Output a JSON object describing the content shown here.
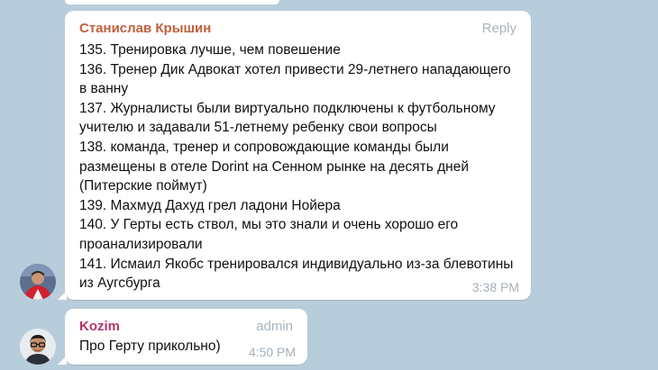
{
  "messages": [
    {
      "sender": "Станислав Крышин",
      "action": "Reply",
      "lines": [
        "135. Тренировка лучше, чем повешение",
        "136. Тренер Дик Адвокат хотел привести 29-летнего нападающего в ванну",
        "137. Журналисты были виртуально подключены к футбольному учителю и задавали 51-летнему ребенку свои вопросы",
        "138. команда, тренер и сопровождающие команды были размещены в отеле Dorint на Сенном рынке на десять дней (Питерские поймут)",
        "139. Махмуд Дахуд грел ладони Нойера",
        "140. У Герты есть ствол, мы это знали и очень хорошо его проанализировали",
        "141. Исмаил Якобс тренировался индивидуально из-за блевотины из Аугсбурга"
      ],
      "time": "3:38 PM"
    },
    {
      "sender": "Kozim",
      "role": "admin",
      "text": "Про Герту прикольно)",
      "time": "4:50 PM"
    }
  ],
  "colors": {
    "chat_background": "#b8cddb",
    "bubble": "#ffffff",
    "sender1": "#c0603c",
    "sender2": "#b1386c",
    "meta_text": "#a7b4bf"
  },
  "icons": {
    "avatar1": "avatar-photo-red-shirt",
    "avatar2": "avatar-photo-man-glasses"
  }
}
